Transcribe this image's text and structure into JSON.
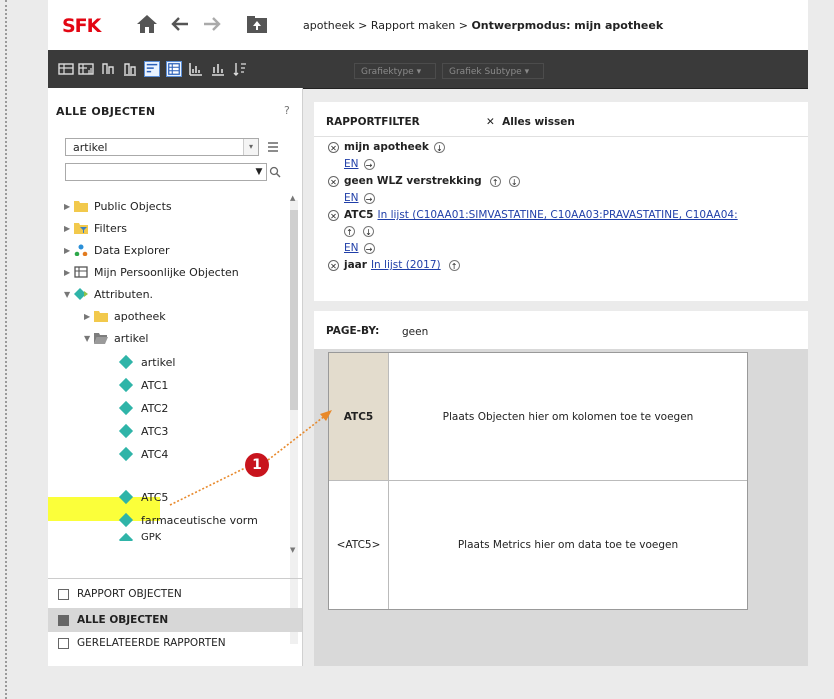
{
  "nav": {
    "logo": "SFK",
    "breadcrumb": {
      "part1": "apotheek",
      "sep1": " > ",
      "part2": "Rapport maken",
      "sep2": " > ",
      "current": "Ontwerpmodus: mijn apotheek"
    }
  },
  "toolbar": {
    "graph_type": "Grafiektype",
    "graph_subtype": "Grafiek Subtype"
  },
  "left_panel": {
    "title": "ALLE OBJECTEN",
    "help": "?",
    "search_value": "artikel",
    "tree": [
      {
        "label": "Public Objects",
        "icon": "folder-icon"
      },
      {
        "label": "Filters",
        "icon": "filter-folder-icon"
      },
      {
        "label": "Data Explorer",
        "icon": "data-explorer-icon"
      },
      {
        "label": "Mijn Persoonlijke Objecten",
        "icon": "personal-objects-icon"
      },
      {
        "label": "Attributen.",
        "icon": "attributes-icon"
      },
      {
        "label": "apotheek",
        "icon": "folder-icon"
      },
      {
        "label": "artikel",
        "icon": "folder-open-icon"
      },
      {
        "label": "artikel",
        "icon": "attribute-icon"
      },
      {
        "label": "ATC1",
        "icon": "attribute-icon"
      },
      {
        "label": "ATC2",
        "icon": "attribute-icon"
      },
      {
        "label": "ATC3",
        "icon": "attribute-icon"
      },
      {
        "label": "ATC4",
        "icon": "attribute-icon"
      },
      {
        "label": "ATC5",
        "icon": "attribute-icon"
      },
      {
        "label": "farmaceutische vorm",
        "icon": "attribute-icon"
      },
      {
        "label": "GPK",
        "icon": "attribute-icon"
      }
    ],
    "bottom_tabs": [
      {
        "label": "RAPPORT OBJECTEN"
      },
      {
        "label": "ALLE OBJECTEN"
      },
      {
        "label": "GERELATEERDE RAPPORTEN"
      }
    ]
  },
  "report_filter": {
    "title": "RAPPORTFILTER",
    "clear": "Alles wissen",
    "items": [
      {
        "name": "mijn apotheek",
        "condition": ""
      },
      {
        "name": "geen WLZ verstrekking",
        "condition": ""
      },
      {
        "name": "ATC5",
        "condition": "In lijst  (C10AA01:SIMVASTATINE, C10AA03:PRAVASTATINE, C10AA04:"
      },
      {
        "name": "jaar",
        "condition": "In lijst  (2017)"
      }
    ],
    "operator": "EN"
  },
  "page_by": {
    "label": "PAGE-BY:",
    "value": "geen"
  },
  "grid": {
    "row_header": "ATC5",
    "column_placeholder": "Plaats Objecten hier om kolomen toe te voegen",
    "row_value": "<ATC5>",
    "metric_placeholder": "Plaats Metrics hier om data toe te voegen"
  },
  "callout": {
    "number": "1"
  },
  "colors": {
    "accent_red": "#c8141d",
    "highlight": "#fbff3a",
    "attribute": "#2fb4a8",
    "link": "#1f3ea8"
  }
}
